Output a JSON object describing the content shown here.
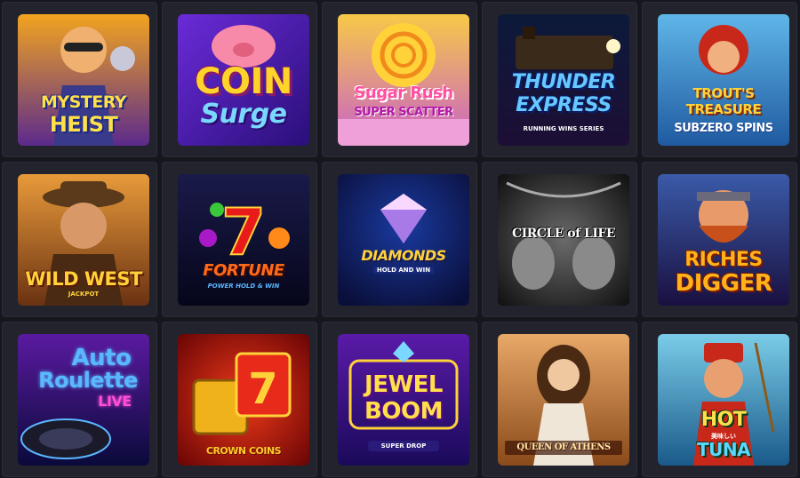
{
  "games": [
    {
      "id": "mystery-heist",
      "lines": [
        "MYSTERY",
        "HEIST"
      ],
      "sub": "",
      "bg": [
        "#f2a41f",
        "#5b2a8c"
      ],
      "text_color": "#ffe04a",
      "stroke": "#1b2a8a"
    },
    {
      "id": "coin-surge",
      "lines": [
        "COIN",
        "Surge"
      ],
      "sub": "",
      "bg": [
        "#6a2bd8",
        "#2a0f7a"
      ],
      "text_color": "#ffd42a",
      "stroke": "#8a1b6a"
    },
    {
      "id": "sugar-rush",
      "lines": [
        "Sugar Rush",
        "SUPER SCATTER"
      ],
      "sub": "",
      "bg": [
        "#f7c948",
        "#c860c8"
      ],
      "text_color": "#ff4fa3",
      "stroke": "#ffffff"
    },
    {
      "id": "thunder-express",
      "lines": [
        "THUNDER",
        "EXPRESS"
      ],
      "sub": "RUNNING WINS SERIES",
      "bg": [
        "#0c1a3a",
        "#1d0e35"
      ],
      "text_color": "#66c8ff",
      "stroke": "#0a1f6a"
    },
    {
      "id": "trouts-treasure",
      "lines": [
        "TROUT'S",
        "TREASURE",
        "SUBZERO SPINS"
      ],
      "sub": "",
      "bg": [
        "#5fb6e8",
        "#1f5aa0"
      ],
      "text_color": "#ffd23a",
      "stroke": "#7a2a10"
    },
    {
      "id": "wild-west",
      "lines": [
        "WILD WEST"
      ],
      "sub": "JACKPOT",
      "bg": [
        "#e89a3a",
        "#6a3212"
      ],
      "text_color": "#ffd23a",
      "stroke": "#5a1a05"
    },
    {
      "id": "7-fortune",
      "lines": [
        "FORTUNE"
      ],
      "sub": "POWER HOLD & WIN",
      "bg": [
        "#1a1a4a",
        "#06061a"
      ],
      "text_color": "#ff6a1a",
      "stroke": "#3a0a00"
    },
    {
      "id": "diamonds",
      "lines": [
        "DIAMONDS"
      ],
      "sub": "HOLD AND WIN",
      "bg": [
        "#1a3aa0",
        "#0a0f3a"
      ],
      "text_color": "#ffd23a",
      "stroke": "#1a1a4a"
    },
    {
      "id": "circle-of-life",
      "lines": [
        "CIRCLE of LIFE"
      ],
      "sub": "",
      "bg": [
        "#6a6a6a",
        "#101010"
      ],
      "text_color": "#ffffff",
      "stroke": "#000000"
    },
    {
      "id": "riches-digger",
      "lines": [
        "RICHES",
        "DIGGER"
      ],
      "sub": "",
      "bg": [
        "#3a5aa8",
        "#1a1040"
      ],
      "text_color": "#ffb21a",
      "stroke": "#7a1a05"
    },
    {
      "id": "auto-roulette",
      "lines": [
        "Auto",
        "Roulette"
      ],
      "sub": "LIVE",
      "bg": [
        "#5a1aa0",
        "#0a0a3a"
      ],
      "text_color": "#5ab8ff",
      "stroke": "#ffffff"
    },
    {
      "id": "crown-coins",
      "lines": [
        "CROWN COINS"
      ],
      "sub": "",
      "bg": [
        "#f03a1a",
        "#6a0505"
      ],
      "text_color": "#ffcc2a",
      "stroke": "#6a0a00"
    },
    {
      "id": "jewel-boom",
      "lines": [
        "JEWEL",
        "BOOM"
      ],
      "sub": "SUPER DROP",
      "bg": [
        "#5a1aa8",
        "#1a0a5a"
      ],
      "text_color": "#ffe04a",
      "stroke": "#5a0a8a"
    },
    {
      "id": "queen-of-athens",
      "lines": [
        "QUEEN OF ATHENS"
      ],
      "sub": "",
      "bg": [
        "#e8a868",
        "#8a4a1a"
      ],
      "text_color": "#ffe6a8",
      "stroke": "#4a1a05"
    },
    {
      "id": "hot-tuna",
      "lines": [
        "HOT",
        "TUNA"
      ],
      "sub": "美味しい",
      "bg": [
        "#7acce8",
        "#1a5a8a"
      ],
      "text_color": "#ffe04a",
      "stroke": "#0a3a1a"
    }
  ]
}
